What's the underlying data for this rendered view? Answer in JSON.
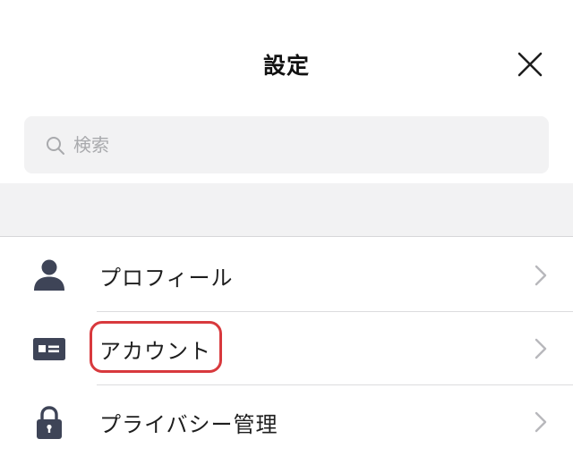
{
  "header": {
    "title": "設定",
    "close_icon": "close-icon"
  },
  "search": {
    "placeholder": "検索",
    "value": "",
    "icon": "search-icon"
  },
  "menu": {
    "items": [
      {
        "label": "プロフィール",
        "icon": "person-icon",
        "chevron": "chevron-right-icon"
      },
      {
        "label": "アカウント",
        "icon": "id-card-icon",
        "chevron": "chevron-right-icon",
        "highlighted": true
      },
      {
        "label": "プライバシー管理",
        "icon": "lock-icon",
        "chevron": "chevron-right-icon"
      }
    ]
  },
  "colors": {
    "icon": "#3e4457",
    "highlight": "#d8393d",
    "search_bg": "#f2f2f3",
    "chevron": "#b8b8bc"
  }
}
